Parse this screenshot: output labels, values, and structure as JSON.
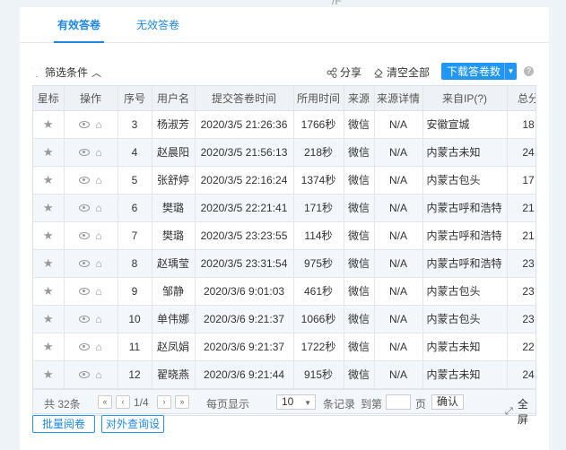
{
  "tabs": [
    {
      "label": "有效答卷",
      "active": true
    },
    {
      "label": "无效答卷",
      "active": false
    }
  ],
  "toolbar": {
    "filter_label": "筛选条件",
    "share_label": "分享",
    "clear_label": "清空全部",
    "download_label": "下载答卷数",
    "help": "?"
  },
  "columns": [
    "星标",
    "操作",
    "序号",
    "用户名",
    "提交答卷时间",
    "所用时间",
    "来源",
    "来源详情",
    "来自IP(?)",
    "总分"
  ],
  "rows": [
    {
      "seq": "3",
      "user": "杨淑芳",
      "time": "2020/3/5 21:26:36",
      "duration": "1766秒",
      "source": "微信",
      "detail": "N/A",
      "ip": "安徽宣城",
      "score": "18"
    },
    {
      "seq": "4",
      "user": "赵晨阳",
      "time": "2020/3/5 21:56:13",
      "duration": "218秒",
      "source": "微信",
      "detail": "N/A",
      "ip": "内蒙古未知",
      "score": "24"
    },
    {
      "seq": "5",
      "user": "张舒婷",
      "time": "2020/3/5 22:16:24",
      "duration": "1374秒",
      "source": "微信",
      "detail": "N/A",
      "ip": "内蒙古包头",
      "score": "17"
    },
    {
      "seq": "6",
      "user": "樊璐",
      "time": "2020/3/5 22:21:41",
      "duration": "171秒",
      "source": "微信",
      "detail": "N/A",
      "ip": "内蒙古呼和浩特",
      "score": "21"
    },
    {
      "seq": "7",
      "user": "樊璐",
      "time": "2020/3/5 23:23:55",
      "duration": "114秒",
      "source": "微信",
      "detail": "N/A",
      "ip": "内蒙古呼和浩特",
      "score": "21"
    },
    {
      "seq": "8",
      "user": "赵瑀莹",
      "time": "2020/3/5 23:31:54",
      "duration": "975秒",
      "source": "微信",
      "detail": "N/A",
      "ip": "内蒙古呼和浩特",
      "score": "23"
    },
    {
      "seq": "9",
      "user": "邹静",
      "time": "2020/3/6 9:01:03",
      "duration": "461秒",
      "source": "微信",
      "detail": "N/A",
      "ip": "内蒙古包头",
      "score": "23"
    },
    {
      "seq": "10",
      "user": "单伟娜",
      "time": "2020/3/6 9:21:37",
      "duration": "1066秒",
      "source": "微信",
      "detail": "N/A",
      "ip": "内蒙古包头",
      "score": "23"
    },
    {
      "seq": "11",
      "user": "赵凤娟",
      "time": "2020/3/6 9:21:37",
      "duration": "1722秒",
      "source": "微信",
      "detail": "N/A",
      "ip": "内蒙古未知",
      "score": "22"
    },
    {
      "seq": "12",
      "user": "翟晓燕",
      "time": "2020/3/6 9:21:44",
      "duration": "915秒",
      "source": "微信",
      "detail": "N/A",
      "ip": "内蒙古未知",
      "score": "24"
    }
  ],
  "icons": {
    "star": "★",
    "eye": "eye-icon",
    "bin": "⌂"
  },
  "pagination": {
    "total": "共 32条",
    "first": "«",
    "prev": "‹",
    "page": "1/4",
    "next": "›",
    "last": "»",
    "per_page_label": "每页显示",
    "per_page_value": "10",
    "records_label": "条记录",
    "goto_label": "到第",
    "page_unit": "页",
    "confirm": "确认",
    "fullscreen": "全屏"
  },
  "bottom_buttons": [
    "批量阅卷",
    "对外查询设"
  ],
  "colors": {
    "accent": "#1e88e5",
    "button": "#2196f3",
    "header_bg": "#eef1f5",
    "stripe": "#f3f6fa"
  }
}
